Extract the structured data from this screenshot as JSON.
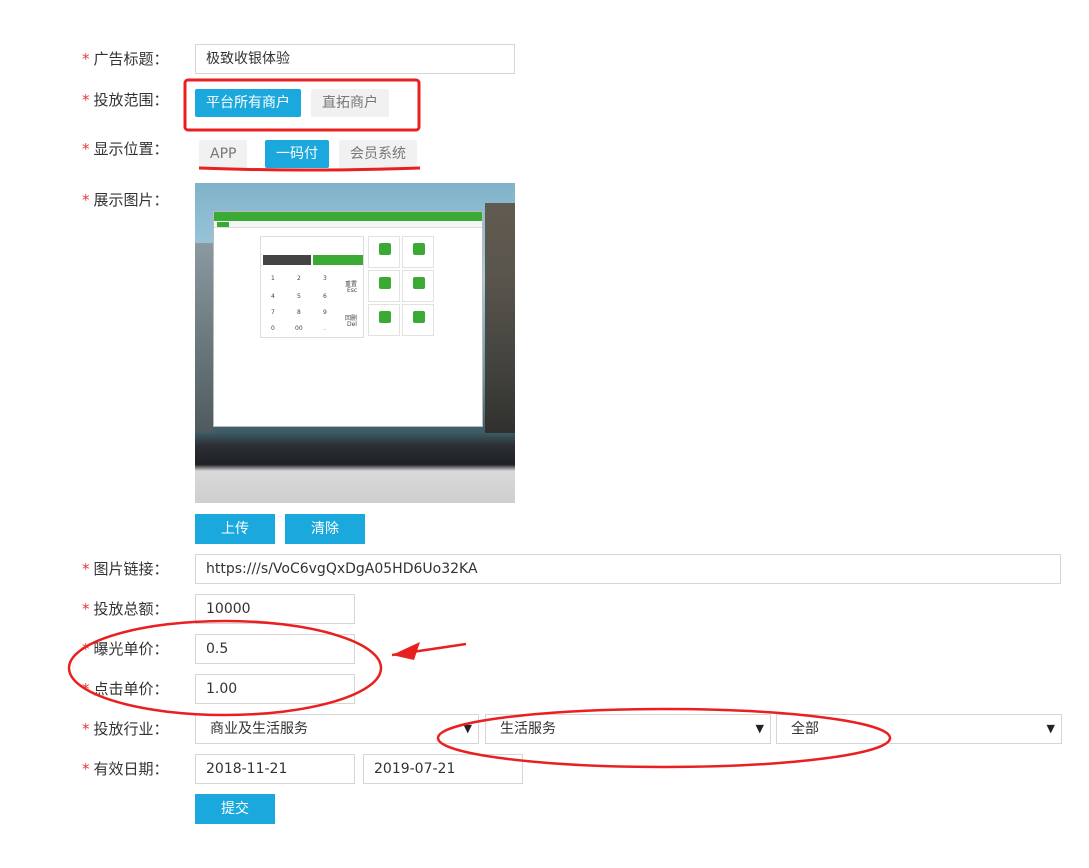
{
  "form": {
    "ad_title": {
      "label": "广告标题：",
      "value": "极致收银体验"
    },
    "scope": {
      "label": "投放范围：",
      "options": [
        "平台所有商户",
        "直拓商户"
      ],
      "selected": "平台所有商户"
    },
    "position": {
      "label": "显示位置：",
      "options": [
        "APP",
        "一码付",
        "会员系统"
      ],
      "selected": "一码付"
    },
    "image": {
      "label": "展示图片：",
      "keypad_keys": [
        "1",
        "2",
        "3",
        "4",
        "5",
        "6",
        "7",
        "8",
        "9",
        "0",
        "00",
        ".",
        "重置",
        "Esc",
        "回删",
        "Del"
      ],
      "upload_label": "上传",
      "clear_label": "清除"
    },
    "image_link": {
      "label": "图片链接：",
      "value": "https:///s/VoC6vgQxDgA05HD6Uo32KA"
    },
    "total_amount": {
      "label": "投放总额：",
      "value": "10000"
    },
    "exposure_price": {
      "label": "曝光单价：",
      "value": "0.5"
    },
    "click_price": {
      "label": "点击单价：",
      "value": "1.00"
    },
    "industry": {
      "label": "投放行业：",
      "level1": "商业及生活服务",
      "level2": "生活服务",
      "level3": "全部"
    },
    "valid_date": {
      "label": "有效日期：",
      "start": "2018-11-21",
      "end": "2019-07-21"
    },
    "submit_label": "提交",
    "required_mark": "*"
  },
  "colors": {
    "accent": "#1aa8dd",
    "annotation": "#e8201f",
    "required": "#e4393c"
  }
}
